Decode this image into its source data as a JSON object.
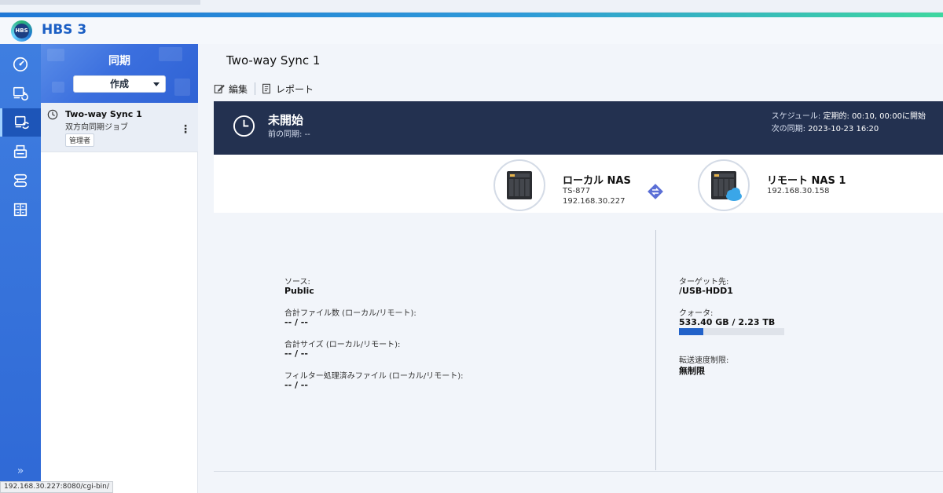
{
  "app": {
    "title": "HBS 3",
    "logo_text": "HBS"
  },
  "rail": {
    "items": [
      {
        "icon": "gauge-icon",
        "active": false
      },
      {
        "icon": "backup-icon",
        "active": false
      },
      {
        "icon": "sync-icon",
        "active": true
      },
      {
        "icon": "restore-icon",
        "active": false
      },
      {
        "icon": "storage-icon",
        "active": false
      },
      {
        "icon": "services-icon",
        "active": false
      }
    ],
    "expand_label": "»"
  },
  "list": {
    "heading": "同期",
    "create_label": "作成",
    "jobs": [
      {
        "name": "Two-way Sync 1",
        "type": "双方向同期ジョブ",
        "owner": "管理者",
        "more": "⋮"
      }
    ]
  },
  "main": {
    "title": "Two-way Sync 1",
    "toolbar": {
      "edit_label": "編集",
      "report_label": "レポート"
    },
    "status": {
      "title": "未開始",
      "last_sync_label": "前の同期:",
      "last_sync_value": "--",
      "schedule_label": "スケジュール:",
      "schedule_value": "定期的: 00:10, 00:00に開始",
      "next_sync_label": "次の同期:",
      "next_sync_value": "2023-10-23 16:20"
    },
    "local": {
      "name": "ローカル NAS",
      "model": "TS-877",
      "ip": "192.168.30.227"
    },
    "remote": {
      "name": "リモート NAS 1",
      "ip": "192.168.30.158"
    },
    "source": {
      "source_label": "ソース:",
      "source_value": "Public",
      "files_label": "合計ファイル数 (ローカル/リモート):",
      "files_value": "-- / --",
      "size_label": "合計サイズ (ローカル/リモート):",
      "size_value": "-- / --",
      "filtered_label": "フィルター処理済みファイル (ローカル/リモート):",
      "filtered_value": "-- / --"
    },
    "target": {
      "target_label": "ターゲット先:",
      "target_value": "/USB-HDD1",
      "quota_label": "クォータ:",
      "quota_used": "533.40 GB",
      "quota_sep": " / ",
      "quota_total": "2.23 TB",
      "quota_fraction": 0.23,
      "limit_label": "転送速度制限:",
      "limit_value": "無制限"
    }
  },
  "statusbar": {
    "url": "192.168.30.227:8080/cgi-bin/"
  },
  "colors": {
    "accent": "#2f69d6",
    "banner": "#233150",
    "quota": "#2262c9"
  }
}
